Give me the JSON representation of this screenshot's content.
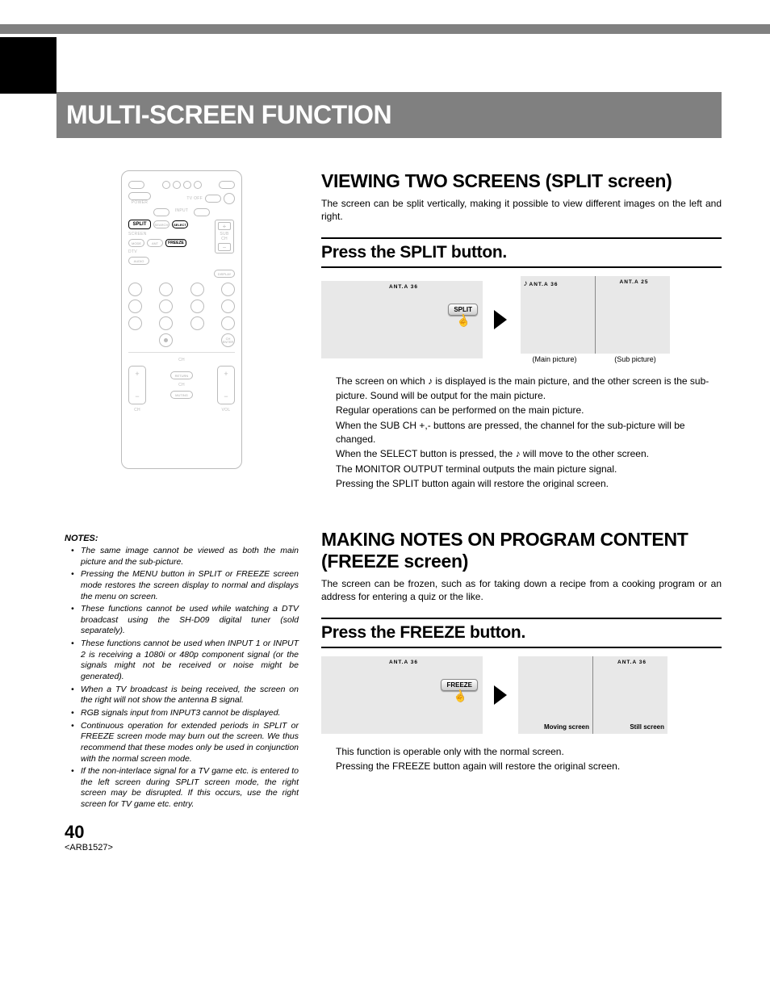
{
  "header": {
    "title": "MULTI-SCREEN FUNCTION"
  },
  "section_split": {
    "heading": "VIEWING TWO SCREENS (SPLIT screen)",
    "intro": "The screen can be split vertically, making it possible to view different images on the left and right.",
    "sub_heading": "Press the SPLIT button.",
    "diagram": {
      "before_caption": "ANT.A 36",
      "button_label": "SPLIT",
      "after_left_caption": "ANT.A 36",
      "after_right_caption": "ANT.A 25",
      "main_label": "(Main picture)",
      "sub_label": "(Sub picture)",
      "music_icon": "♪"
    },
    "body": [
      "The screen on which ♪ is displayed is the main picture, and the other screen is the sub-picture. Sound will be output for the main picture.",
      "Regular operations can be performed on the main picture.",
      "When the SUB CH +,- buttons are pressed, the channel for the sub-picture will be changed.",
      "When the SELECT button is pressed, the ♪ will move to the other screen.",
      "The MONITOR OUTPUT terminal outputs the main picture signal.",
      "Pressing the SPLIT button again will restore the original screen."
    ]
  },
  "section_freeze": {
    "heading": "MAKING NOTES ON PROGRAM CONTENT (FREEZE screen)",
    "intro": "The screen can be frozen, such as for taking down a recipe from a cooking program or an address for entering a quiz or the like.",
    "sub_heading": "Press the FREEZE button.",
    "diagram": {
      "before_caption": "ANT.A 36",
      "button_label": "FREEZE",
      "after_right_caption": "ANT.A 36",
      "moving_label": "Moving screen",
      "still_label": "Still screen"
    },
    "body": [
      "This function is operable only with the normal screen.",
      "Pressing the FREEZE button again will restore the original screen."
    ]
  },
  "remote": {
    "split": "SPLIT",
    "freeze": "FREEZE",
    "select": "SELECT",
    "search": "SEARCH",
    "subch_label": "SUB CH",
    "input": "INPUT",
    "screen": "SCREEN",
    "mode": "MODE",
    "ant": "ANT",
    "dtv": "DTV",
    "audio": "AUDIO",
    "display": "DISPLAY",
    "ch_enter": "CH ENTER",
    "ch": "CH",
    "vol": "VOL",
    "return": "RETURN",
    "muting": "MUTING",
    "power": "POWER",
    "tv_off": "TV OFF"
  },
  "notes": {
    "heading": "NOTES:",
    "items": [
      "The same image cannot be viewed as both the main picture and the sub-picture.",
      "Pressing the MENU button in SPLIT or FREEZE screen mode restores the screen display to normal and displays the menu on screen.",
      "These functions cannot be used while watching a DTV broadcast using the SH-D09 digital tuner (sold separately).",
      "These functions cannot be used when INPUT 1 or INPUT 2 is receiving a 1080i or 480p component signal (or the signals might not be received or noise might be generated).",
      "When a TV broadcast is being received, the screen on the right will not show the antenna B signal.",
      "RGB signals input from INPUT3 cannot be displayed.",
      "Continuous operation for extended periods in SPLIT or FREEZE screen mode may burn out the screen. We thus recommend that these modes only be used in conjunction with the normal screen mode.",
      "If the non-interlace signal for a TV game etc. is entered to the left screen during SPLIT screen mode, the right screen may be disrupted. If this occurs, use the right screen for TV game etc. entry."
    ]
  },
  "footer": {
    "page": "40",
    "ref": "<ARB1527>"
  }
}
